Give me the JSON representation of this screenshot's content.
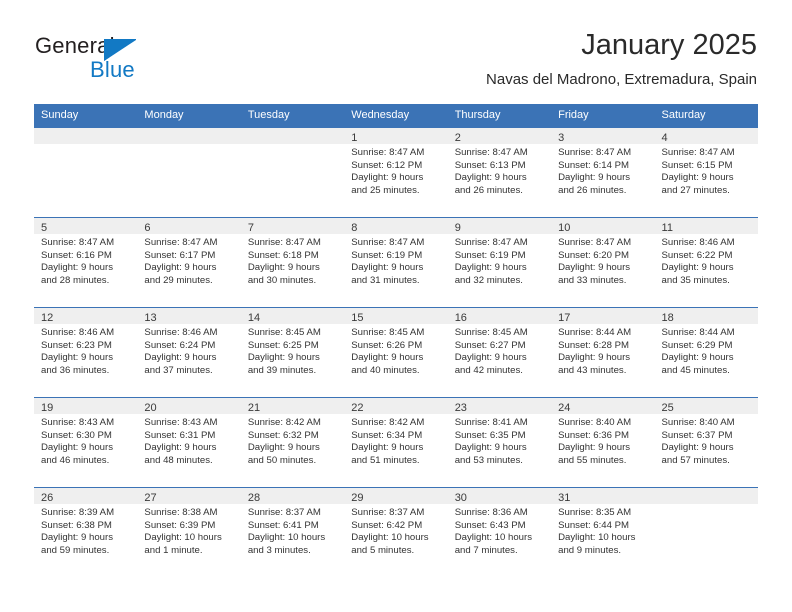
{
  "brand": {
    "name_part1": "General",
    "name_part2": "Blue",
    "accent_color": "#1279c4",
    "logo_icon": "triangle-flag-icon"
  },
  "header": {
    "title": "January 2025",
    "location": "Navas del Madrono, Extremadura, Spain"
  },
  "calendar": {
    "header_bg": "#3b73b6",
    "daynum_bg": "#efefef",
    "weekdays": [
      "Sunday",
      "Monday",
      "Tuesday",
      "Wednesday",
      "Thursday",
      "Friday",
      "Saturday"
    ],
    "weeks": [
      [
        {
          "day": "",
          "lines": []
        },
        {
          "day": "",
          "lines": []
        },
        {
          "day": "",
          "lines": []
        },
        {
          "day": "1",
          "lines": [
            "Sunrise: 8:47 AM",
            "Sunset: 6:12 PM",
            "Daylight: 9 hours",
            "and 25 minutes."
          ]
        },
        {
          "day": "2",
          "lines": [
            "Sunrise: 8:47 AM",
            "Sunset: 6:13 PM",
            "Daylight: 9 hours",
            "and 26 minutes."
          ]
        },
        {
          "day": "3",
          "lines": [
            "Sunrise: 8:47 AM",
            "Sunset: 6:14 PM",
            "Daylight: 9 hours",
            "and 26 minutes."
          ]
        },
        {
          "day": "4",
          "lines": [
            "Sunrise: 8:47 AM",
            "Sunset: 6:15 PM",
            "Daylight: 9 hours",
            "and 27 minutes."
          ]
        }
      ],
      [
        {
          "day": "5",
          "lines": [
            "Sunrise: 8:47 AM",
            "Sunset: 6:16 PM",
            "Daylight: 9 hours",
            "and 28 minutes."
          ]
        },
        {
          "day": "6",
          "lines": [
            "Sunrise: 8:47 AM",
            "Sunset: 6:17 PM",
            "Daylight: 9 hours",
            "and 29 minutes."
          ]
        },
        {
          "day": "7",
          "lines": [
            "Sunrise: 8:47 AM",
            "Sunset: 6:18 PM",
            "Daylight: 9 hours",
            "and 30 minutes."
          ]
        },
        {
          "day": "8",
          "lines": [
            "Sunrise: 8:47 AM",
            "Sunset: 6:19 PM",
            "Daylight: 9 hours",
            "and 31 minutes."
          ]
        },
        {
          "day": "9",
          "lines": [
            "Sunrise: 8:47 AM",
            "Sunset: 6:19 PM",
            "Daylight: 9 hours",
            "and 32 minutes."
          ]
        },
        {
          "day": "10",
          "lines": [
            "Sunrise: 8:47 AM",
            "Sunset: 6:20 PM",
            "Daylight: 9 hours",
            "and 33 minutes."
          ]
        },
        {
          "day": "11",
          "lines": [
            "Sunrise: 8:46 AM",
            "Sunset: 6:22 PM",
            "Daylight: 9 hours",
            "and 35 minutes."
          ]
        }
      ],
      [
        {
          "day": "12",
          "lines": [
            "Sunrise: 8:46 AM",
            "Sunset: 6:23 PM",
            "Daylight: 9 hours",
            "and 36 minutes."
          ]
        },
        {
          "day": "13",
          "lines": [
            "Sunrise: 8:46 AM",
            "Sunset: 6:24 PM",
            "Daylight: 9 hours",
            "and 37 minutes."
          ]
        },
        {
          "day": "14",
          "lines": [
            "Sunrise: 8:45 AM",
            "Sunset: 6:25 PM",
            "Daylight: 9 hours",
            "and 39 minutes."
          ]
        },
        {
          "day": "15",
          "lines": [
            "Sunrise: 8:45 AM",
            "Sunset: 6:26 PM",
            "Daylight: 9 hours",
            "and 40 minutes."
          ]
        },
        {
          "day": "16",
          "lines": [
            "Sunrise: 8:45 AM",
            "Sunset: 6:27 PM",
            "Daylight: 9 hours",
            "and 42 minutes."
          ]
        },
        {
          "day": "17",
          "lines": [
            "Sunrise: 8:44 AM",
            "Sunset: 6:28 PM",
            "Daylight: 9 hours",
            "and 43 minutes."
          ]
        },
        {
          "day": "18",
          "lines": [
            "Sunrise: 8:44 AM",
            "Sunset: 6:29 PM",
            "Daylight: 9 hours",
            "and 45 minutes."
          ]
        }
      ],
      [
        {
          "day": "19",
          "lines": [
            "Sunrise: 8:43 AM",
            "Sunset: 6:30 PM",
            "Daylight: 9 hours",
            "and 46 minutes."
          ]
        },
        {
          "day": "20",
          "lines": [
            "Sunrise: 8:43 AM",
            "Sunset: 6:31 PM",
            "Daylight: 9 hours",
            "and 48 minutes."
          ]
        },
        {
          "day": "21",
          "lines": [
            "Sunrise: 8:42 AM",
            "Sunset: 6:32 PM",
            "Daylight: 9 hours",
            "and 50 minutes."
          ]
        },
        {
          "day": "22",
          "lines": [
            "Sunrise: 8:42 AM",
            "Sunset: 6:34 PM",
            "Daylight: 9 hours",
            "and 51 minutes."
          ]
        },
        {
          "day": "23",
          "lines": [
            "Sunrise: 8:41 AM",
            "Sunset: 6:35 PM",
            "Daylight: 9 hours",
            "and 53 minutes."
          ]
        },
        {
          "day": "24",
          "lines": [
            "Sunrise: 8:40 AM",
            "Sunset: 6:36 PM",
            "Daylight: 9 hours",
            "and 55 minutes."
          ]
        },
        {
          "day": "25",
          "lines": [
            "Sunrise: 8:40 AM",
            "Sunset: 6:37 PM",
            "Daylight: 9 hours",
            "and 57 minutes."
          ]
        }
      ],
      [
        {
          "day": "26",
          "lines": [
            "Sunrise: 8:39 AM",
            "Sunset: 6:38 PM",
            "Daylight: 9 hours",
            "and 59 minutes."
          ]
        },
        {
          "day": "27",
          "lines": [
            "Sunrise: 8:38 AM",
            "Sunset: 6:39 PM",
            "Daylight: 10 hours",
            "and 1 minute."
          ]
        },
        {
          "day": "28",
          "lines": [
            "Sunrise: 8:37 AM",
            "Sunset: 6:41 PM",
            "Daylight: 10 hours",
            "and 3 minutes."
          ]
        },
        {
          "day": "29",
          "lines": [
            "Sunrise: 8:37 AM",
            "Sunset: 6:42 PM",
            "Daylight: 10 hours",
            "and 5 minutes."
          ]
        },
        {
          "day": "30",
          "lines": [
            "Sunrise: 8:36 AM",
            "Sunset: 6:43 PM",
            "Daylight: 10 hours",
            "and 7 minutes."
          ]
        },
        {
          "day": "31",
          "lines": [
            "Sunrise: 8:35 AM",
            "Sunset: 6:44 PM",
            "Daylight: 10 hours",
            "and 9 minutes."
          ]
        },
        {
          "day": "",
          "lines": []
        }
      ]
    ]
  }
}
